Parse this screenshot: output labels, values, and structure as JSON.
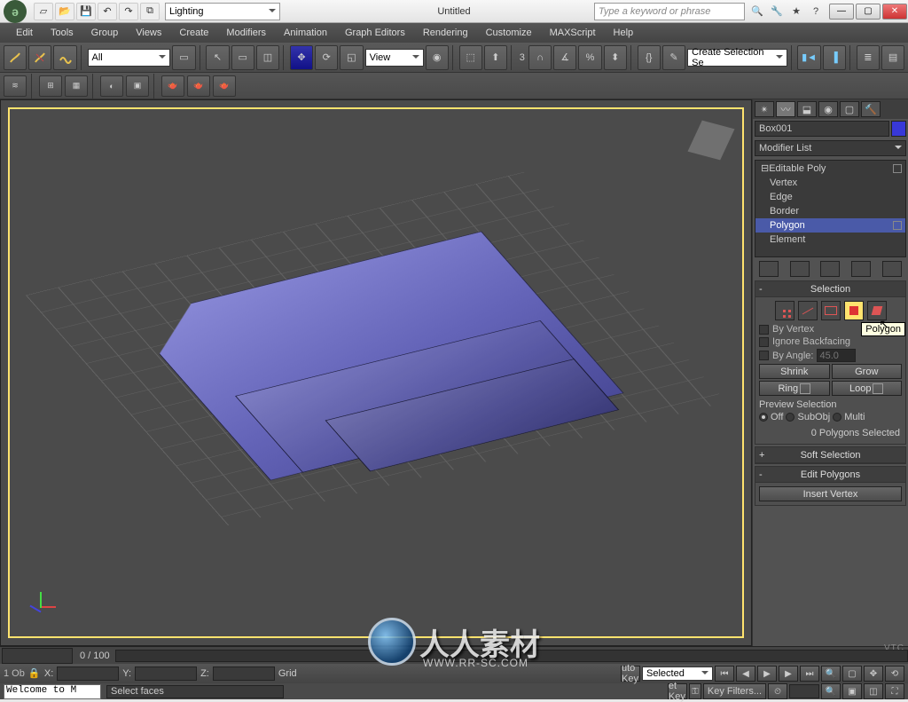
{
  "title": "Untitled",
  "workspace_dd": "Lighting",
  "search_placeholder": "Type a keyword or phrase",
  "menus": [
    "Edit",
    "Tools",
    "Group",
    "Views",
    "Create",
    "Modifiers",
    "Animation",
    "Graph Editors",
    "Rendering",
    "Customize",
    "MAXScript",
    "Help"
  ],
  "main_toolbar": {
    "filter_dd": "All",
    "ref_dd": "View",
    "angle_label": "3",
    "selset_dd": "Create Selection Se"
  },
  "cmd_panel": {
    "object_name": "Box001",
    "modifier_dd": "Modifier List",
    "stack": {
      "root": "Editable Poly",
      "subs": [
        "Vertex",
        "Edge",
        "Border",
        "Polygon",
        "Element"
      ],
      "selected": "Polygon"
    },
    "selection": {
      "title": "Selection",
      "by_vertex": "By Vertex",
      "ignore_backfacing": "Ignore Backfacing",
      "by_angle": "By Angle:",
      "angle_val": "45.0",
      "shrink": "Shrink",
      "grow": "Grow",
      "ring": "Ring",
      "loop": "Loop",
      "preview_label": "Preview Selection",
      "radios": [
        "Off",
        "SubObj",
        "Multi"
      ],
      "count": "0 Polygons Selected",
      "tooltip": "Polygon"
    },
    "rollouts": [
      "Soft Selection",
      "Edit Polygons",
      "Insert Vertex"
    ]
  },
  "timeline": {
    "range": "0 / 100"
  },
  "status": {
    "welcome": "Welcome to M",
    "obj_count": "1 Ob",
    "x": "X:",
    "y": "Y:",
    "z": "Z:",
    "grid": "Grid",
    "prompt": "Select faces",
    "autokey": "uto Key",
    "setkey": "et Key",
    "selected_dd": "Selected",
    "keyfilters": "Key Filters..."
  },
  "watermark": {
    "main": "人人素材",
    "sub": "WWW.RR-SC.COM"
  },
  "vtc": "VTC"
}
